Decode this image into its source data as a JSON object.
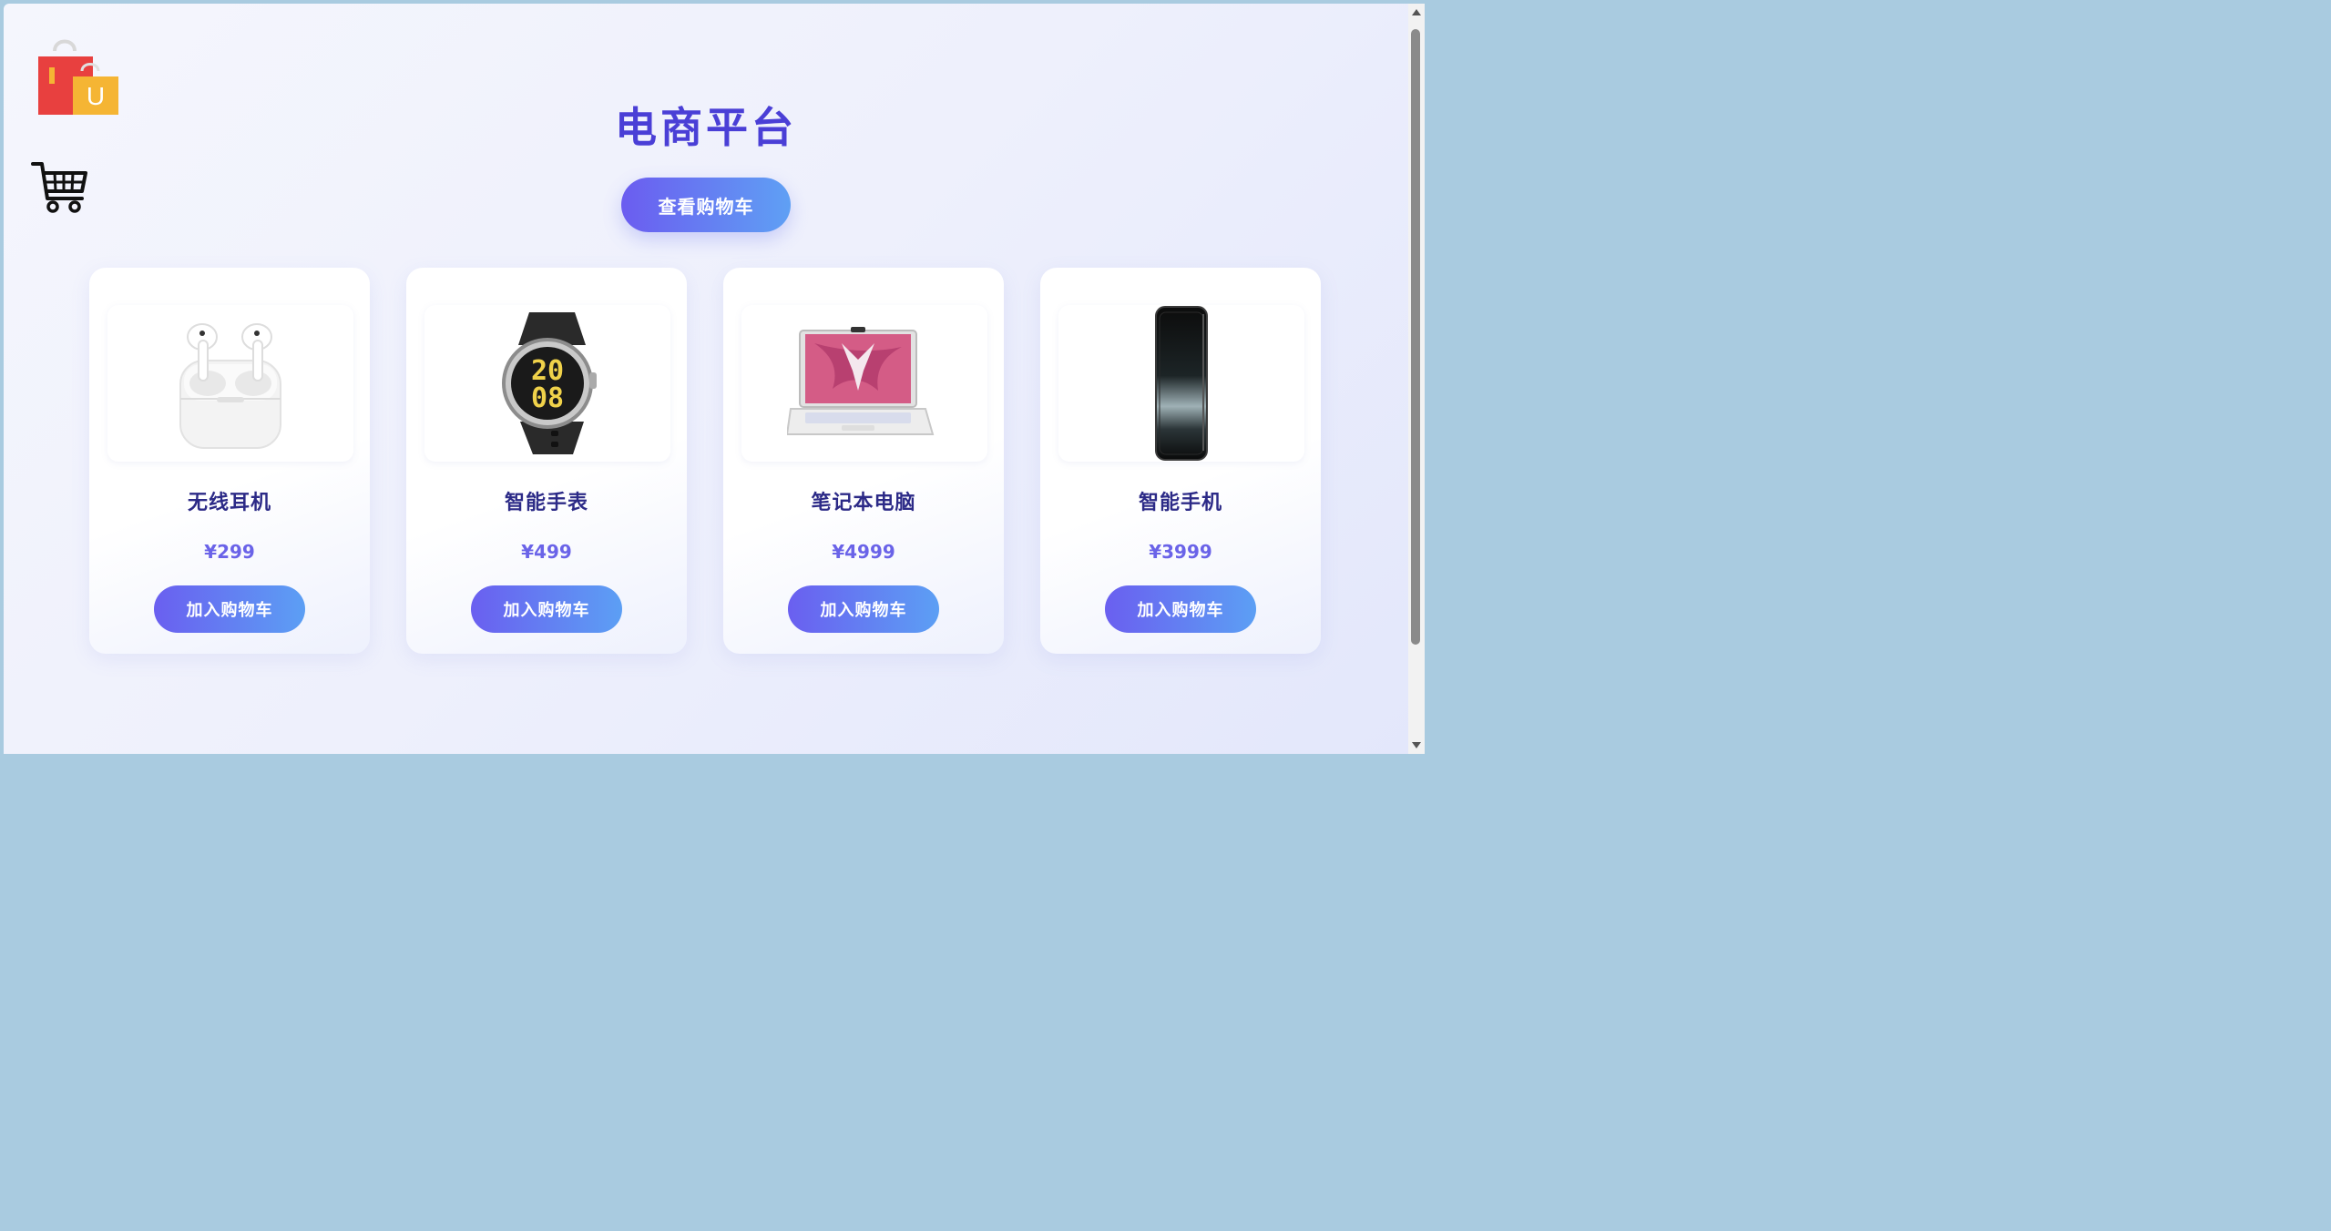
{
  "header": {
    "title": "电商平台",
    "view_cart_label": "查看购物车",
    "logo_letter": "U",
    "logo_icon": "shopping-bags-logo",
    "cart_icon": "shopping-cart-icon"
  },
  "products": [
    {
      "name": "无线耳机",
      "price": "¥299",
      "button": "加入购物车",
      "icon": "earbuds-image"
    },
    {
      "name": "智能手表",
      "price": "¥499",
      "button": "加入购物车",
      "icon": "smartwatch-image",
      "watch_time_top": "20",
      "watch_time_bottom": "08"
    },
    {
      "name": "笔记本电脑",
      "price": "¥4999",
      "button": "加入购物车",
      "icon": "laptop-image"
    },
    {
      "name": "智能手机",
      "price": "¥3999",
      "button": "加入购物车",
      "icon": "smartphone-image"
    }
  ],
  "colors": {
    "title": "#4a3fd6",
    "button_gradient_start": "#6a5ff0",
    "button_gradient_end": "#5c9ff4",
    "price": "#6a63e8",
    "product_name": "#2c2a87"
  }
}
